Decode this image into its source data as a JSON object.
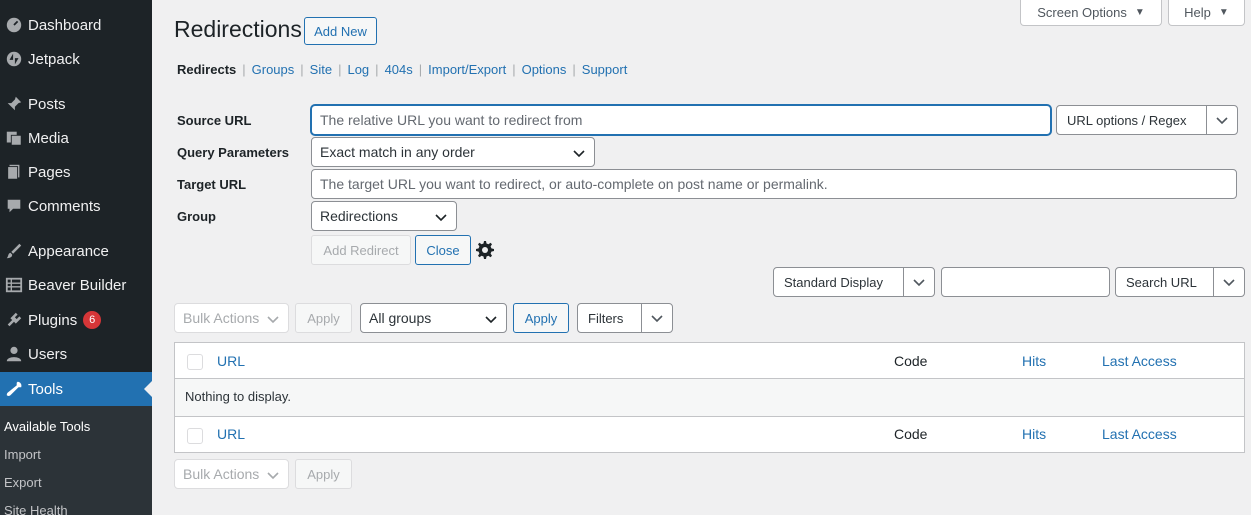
{
  "sidebar": {
    "items": [
      {
        "label": "Dashboard",
        "icon": "dashboard-icon"
      },
      {
        "label": "Jetpack",
        "icon": "jetpack-icon"
      },
      {
        "label": "Posts",
        "icon": "pin-icon"
      },
      {
        "label": "Media",
        "icon": "media-icon"
      },
      {
        "label": "Pages",
        "icon": "pages-icon"
      },
      {
        "label": "Comments",
        "icon": "comment-icon"
      },
      {
        "label": "Appearance",
        "icon": "brush-icon"
      },
      {
        "label": "Beaver Builder",
        "icon": "grid-icon"
      },
      {
        "label": "Plugins",
        "icon": "plugin-icon",
        "badge": "6"
      },
      {
        "label": "Users",
        "icon": "user-icon"
      },
      {
        "label": "Tools",
        "icon": "wrench-icon",
        "active": true
      }
    ],
    "submenu": [
      "Available Tools",
      "Import",
      "Export",
      "Site Health"
    ]
  },
  "top": {
    "screen_options": "Screen Options",
    "help": "Help"
  },
  "page": {
    "title": "Redirections",
    "add_new": "Add New"
  },
  "subnav": [
    "Redirects",
    "Groups",
    "Site",
    "Log",
    "404s",
    "Import/Export",
    "Options",
    "Support"
  ],
  "form": {
    "source_label": "Source URL",
    "source_placeholder": "The relative URL you want to redirect from",
    "url_options": "URL options / Regex",
    "query_label": "Query Parameters",
    "query_value": "Exact match in any order",
    "target_label": "Target URL",
    "target_placeholder": "The target URL you want to redirect, or auto-complete on post name or permalink.",
    "group_label": "Group",
    "group_value": "Redirections",
    "add_redirect": "Add Redirect",
    "close": "Close"
  },
  "search": {
    "display": "Standard Display",
    "value": "",
    "mode": "Search URL"
  },
  "toolbar": {
    "bulk_actions": "Bulk Actions",
    "apply": "Apply",
    "groups": "All groups",
    "apply2": "Apply",
    "filters": "Filters"
  },
  "table": {
    "columns": [
      "URL",
      "Code",
      "Hits",
      "Last Access"
    ],
    "empty": "Nothing to display."
  },
  "bottom": {
    "bulk_actions": "Bulk Actions",
    "apply": "Apply"
  },
  "colors": {
    "accent": "#2271b1",
    "sidebar": "#1d2327",
    "badge": "#d63638"
  }
}
